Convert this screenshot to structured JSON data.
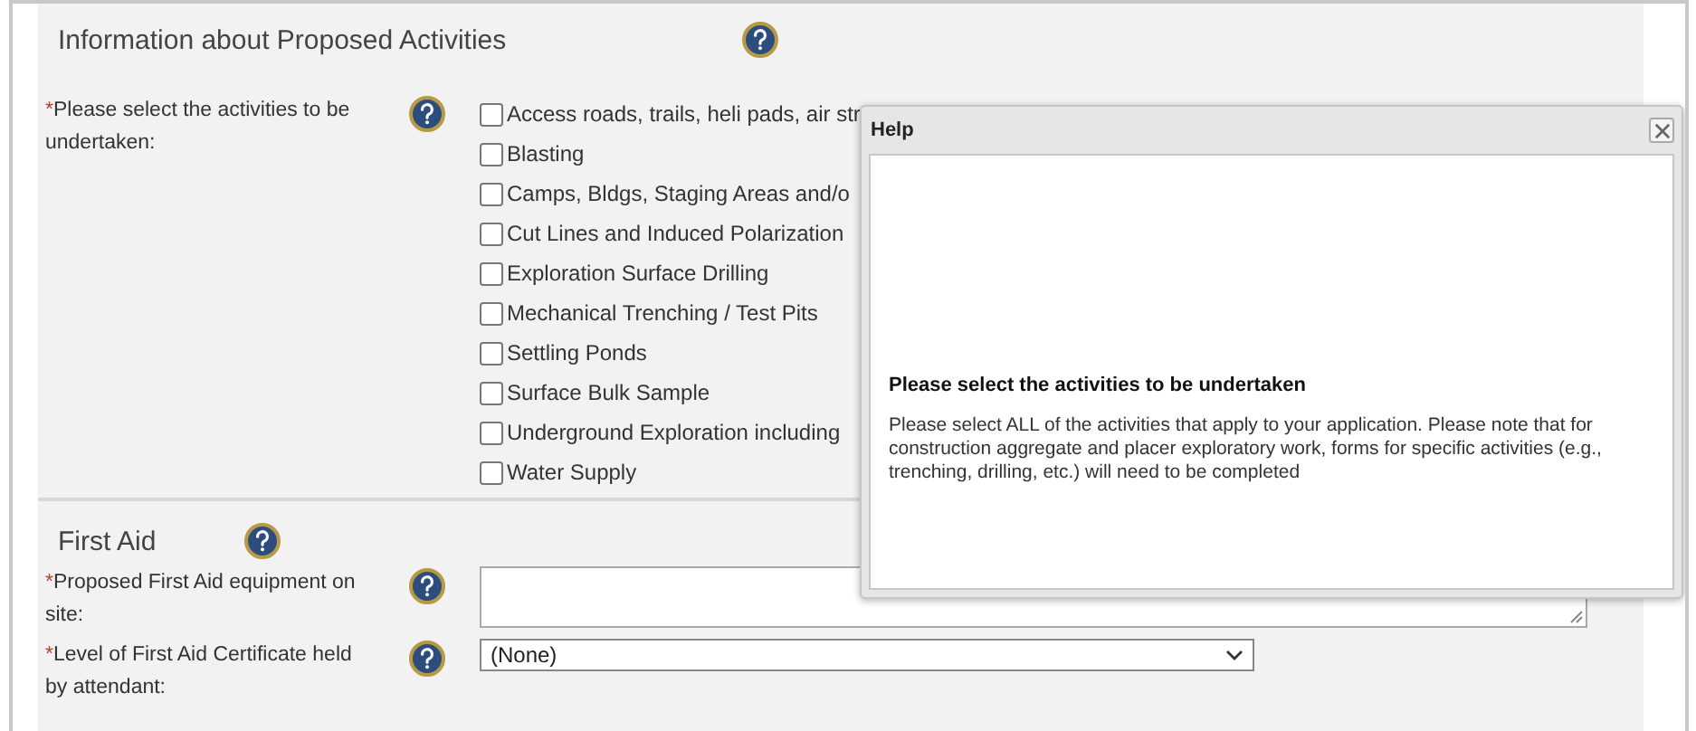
{
  "sections": [
    {
      "title": "Information about Proposed Activities",
      "fields": [
        {
          "kind": "checklist",
          "required_mark": "*",
          "label": "Please select the activities to be undertaken:",
          "options": [
            {
              "label": "Access roads, trails, heli pads, air str",
              "checked": false
            },
            {
              "label": "Blasting",
              "checked": false
            },
            {
              "label": "Camps, Bldgs, Staging Areas and/o",
              "checked": false
            },
            {
              "label": "Cut Lines and Induced Polarization",
              "checked": false
            },
            {
              "label": "Exploration Surface Drilling",
              "checked": false
            },
            {
              "label": "Mechanical Trenching / Test Pits",
              "checked": false
            },
            {
              "label": "Settling Ponds",
              "checked": false
            },
            {
              "label": "Surface Bulk Sample",
              "checked": false
            },
            {
              "label": "Underground Exploration including",
              "checked": false
            },
            {
              "label": "Water Supply",
              "checked": false
            }
          ]
        }
      ]
    },
    {
      "title": "First Aid",
      "fields": [
        {
          "kind": "textarea",
          "required_mark": "*",
          "label": "Proposed First Aid equipment on site:"
        },
        {
          "kind": "select",
          "required_mark": "*",
          "label": "Level of First Aid Certificate held by attendant:",
          "value": "(None)"
        }
      ]
    }
  ],
  "dialog": {
    "title": "Help",
    "heading": "Please select the activities to be undertaken",
    "body": "Please select ALL of the activities that apply to your application. Please note that for construction aggregate and placer exploratory work, forms for specific activities (e.g., trenching, drilling, etc.) will need to be completed"
  }
}
